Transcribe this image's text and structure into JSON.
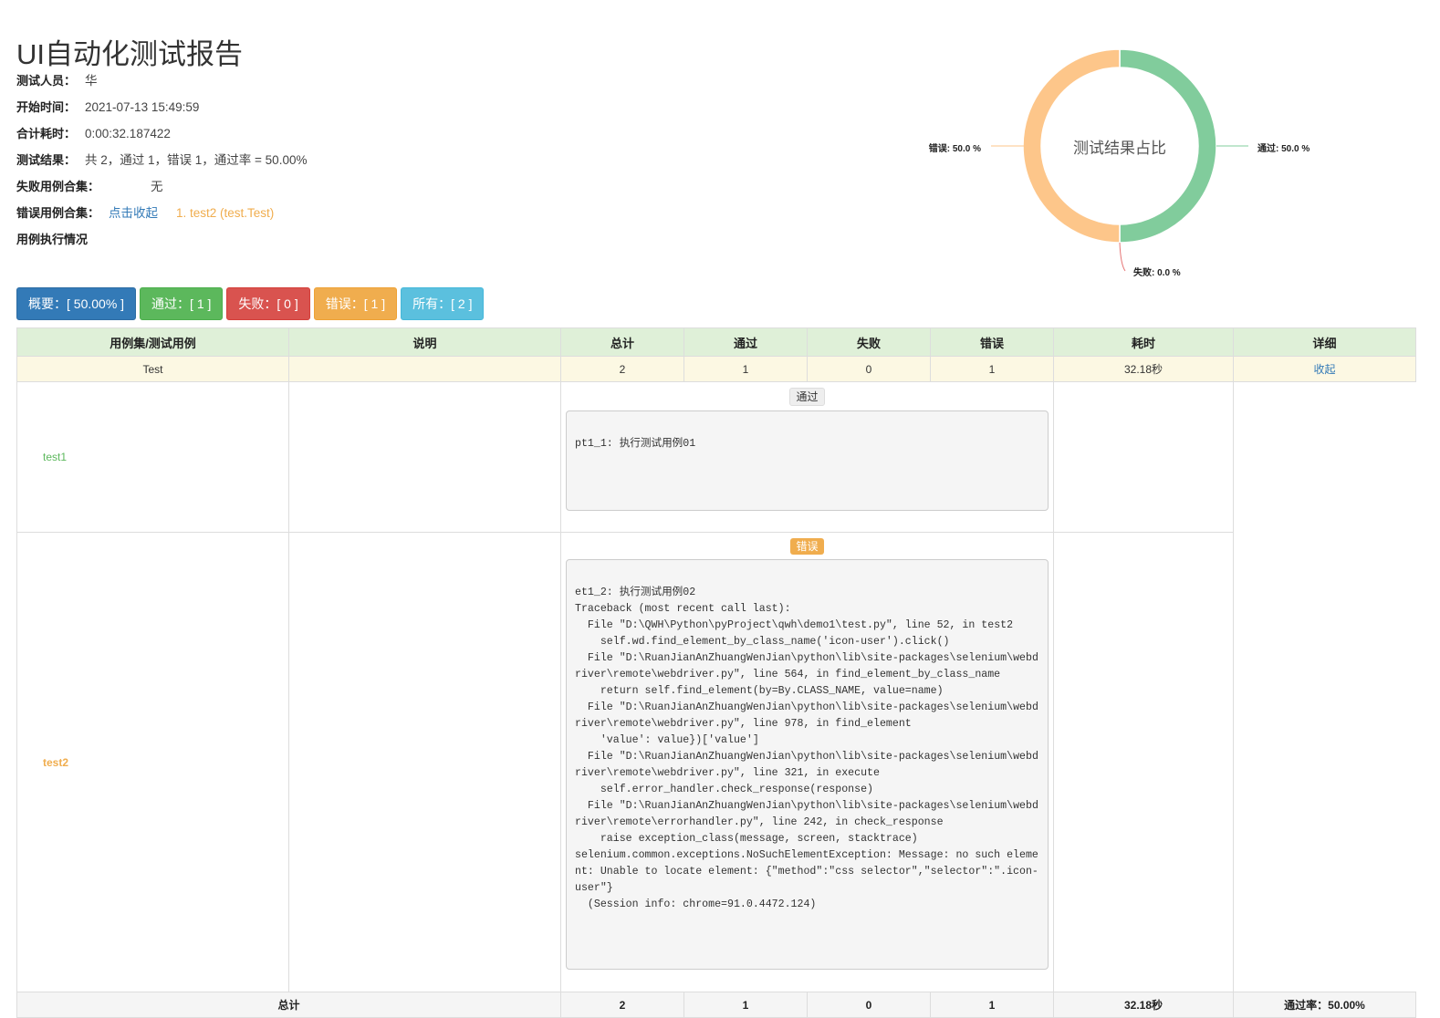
{
  "report": {
    "title": "UI自动化测试报告",
    "tester_label": "测试人员：",
    "tester": "华",
    "start_label": "开始时间：",
    "start": "2021-07-13 15:49:59",
    "duration_label": "合计耗时：",
    "duration": "0:00:32.187422",
    "result_label": "测试结果：",
    "result": "共 2，通过 1，错误 1，通过率 = 50.00%",
    "failed_label": "失败用例合集：",
    "failed_value": "无",
    "error_label": "错误用例合集：",
    "error_toggle": "点击收起",
    "error_item": "1. test2 (test.Test)",
    "exec_label": "用例执行情况"
  },
  "chart": {
    "center_title": "测试结果占比",
    "label_error": "错误: 50.0 %",
    "label_pass": "通过: 50.0 %",
    "label_fail": "失败: 0.0 %",
    "pass_color": "#81cc9c",
    "error_color": "#fdc68a",
    "fail_color": "#e57373"
  },
  "chart_data": {
    "type": "pie",
    "categories": [
      "通过",
      "错误",
      "失败"
    ],
    "values": [
      50.0,
      50.0,
      0.0
    ],
    "title": "测试结果占比"
  },
  "filters": {
    "summary": "概要：[ 50.00% ]",
    "pass": "通过：[ 1 ]",
    "fail": "失败：[ 0 ]",
    "error": "错误：[ 1 ]",
    "all": "所有：[ 2 ]"
  },
  "table": {
    "headers": [
      "用例集/测试用例",
      "说明",
      "总计",
      "通过",
      "失败",
      "错误",
      "耗时",
      "详细"
    ],
    "suite": {
      "name": "Test",
      "desc": "",
      "total": "2",
      "pass": "1",
      "fail": "0",
      "error": "1",
      "time": "32.18秒",
      "detail": "收起"
    },
    "cases": [
      {
        "name": "test1",
        "status": "通过",
        "output": "\npt1_1: 执行测试用例01\n\n\n"
      },
      {
        "name": "test2",
        "status": "错误",
        "output": "\net1_2: 执行测试用例02\nTraceback (most recent call last):\n  File \"D:\\QWH\\Python\\pyProject\\qwh\\demo1\\test.py\", line 52, in test2\n    self.wd.find_element_by_class_name('icon-user').click()\n  File \"D:\\RuanJianAnZhuangWenJian\\python\\lib\\site-packages\\selenium\\webdriver\\remote\\webdriver.py\", line 564, in find_element_by_class_name\n    return self.find_element(by=By.CLASS_NAME, value=name)\n  File \"D:\\RuanJianAnZhuangWenJian\\python\\lib\\site-packages\\selenium\\webdriver\\remote\\webdriver.py\", line 978, in find_element\n    'value': value})['value']\n  File \"D:\\RuanJianAnZhuangWenJian\\python\\lib\\site-packages\\selenium\\webdriver\\remote\\webdriver.py\", line 321, in execute\n    self.error_handler.check_response(response)\n  File \"D:\\RuanJianAnZhuangWenJian\\python\\lib\\site-packages\\selenium\\webdriver\\remote\\errorhandler.py\", line 242, in check_response\n    raise exception_class(message, screen, stacktrace)\nselenium.common.exceptions.NoSuchElementException: Message: no such element: Unable to locate element: {\"method\":\"css selector\",\"selector\":\".icon-user\"}\n  (Session info: chrome=91.0.4472.124)\n\n\n\n\n\n"
      }
    ],
    "total": {
      "label": "总计",
      "total": "2",
      "pass": "1",
      "fail": "0",
      "error": "1",
      "time": "32.18秒",
      "rate": "通过率：50.00%"
    }
  }
}
